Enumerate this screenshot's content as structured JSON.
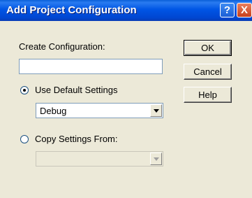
{
  "window": {
    "title": "Add Project Configuration",
    "help_glyph": "?",
    "close_glyph": "X"
  },
  "form": {
    "create_label": "Create Configuration:",
    "create_value": "",
    "use_default_label": "Use Default Settings",
    "use_default_selected": true,
    "default_settings_value": "Debug",
    "copy_from_label": "Copy Settings From:",
    "copy_from_selected": false,
    "copy_from_value": ""
  },
  "buttons": {
    "ok": "OK",
    "cancel": "Cancel",
    "help": "Help"
  },
  "colors": {
    "titlebar": "#0055e5",
    "dialog_bg": "#ece9d8",
    "close_button": "#c6401d"
  }
}
